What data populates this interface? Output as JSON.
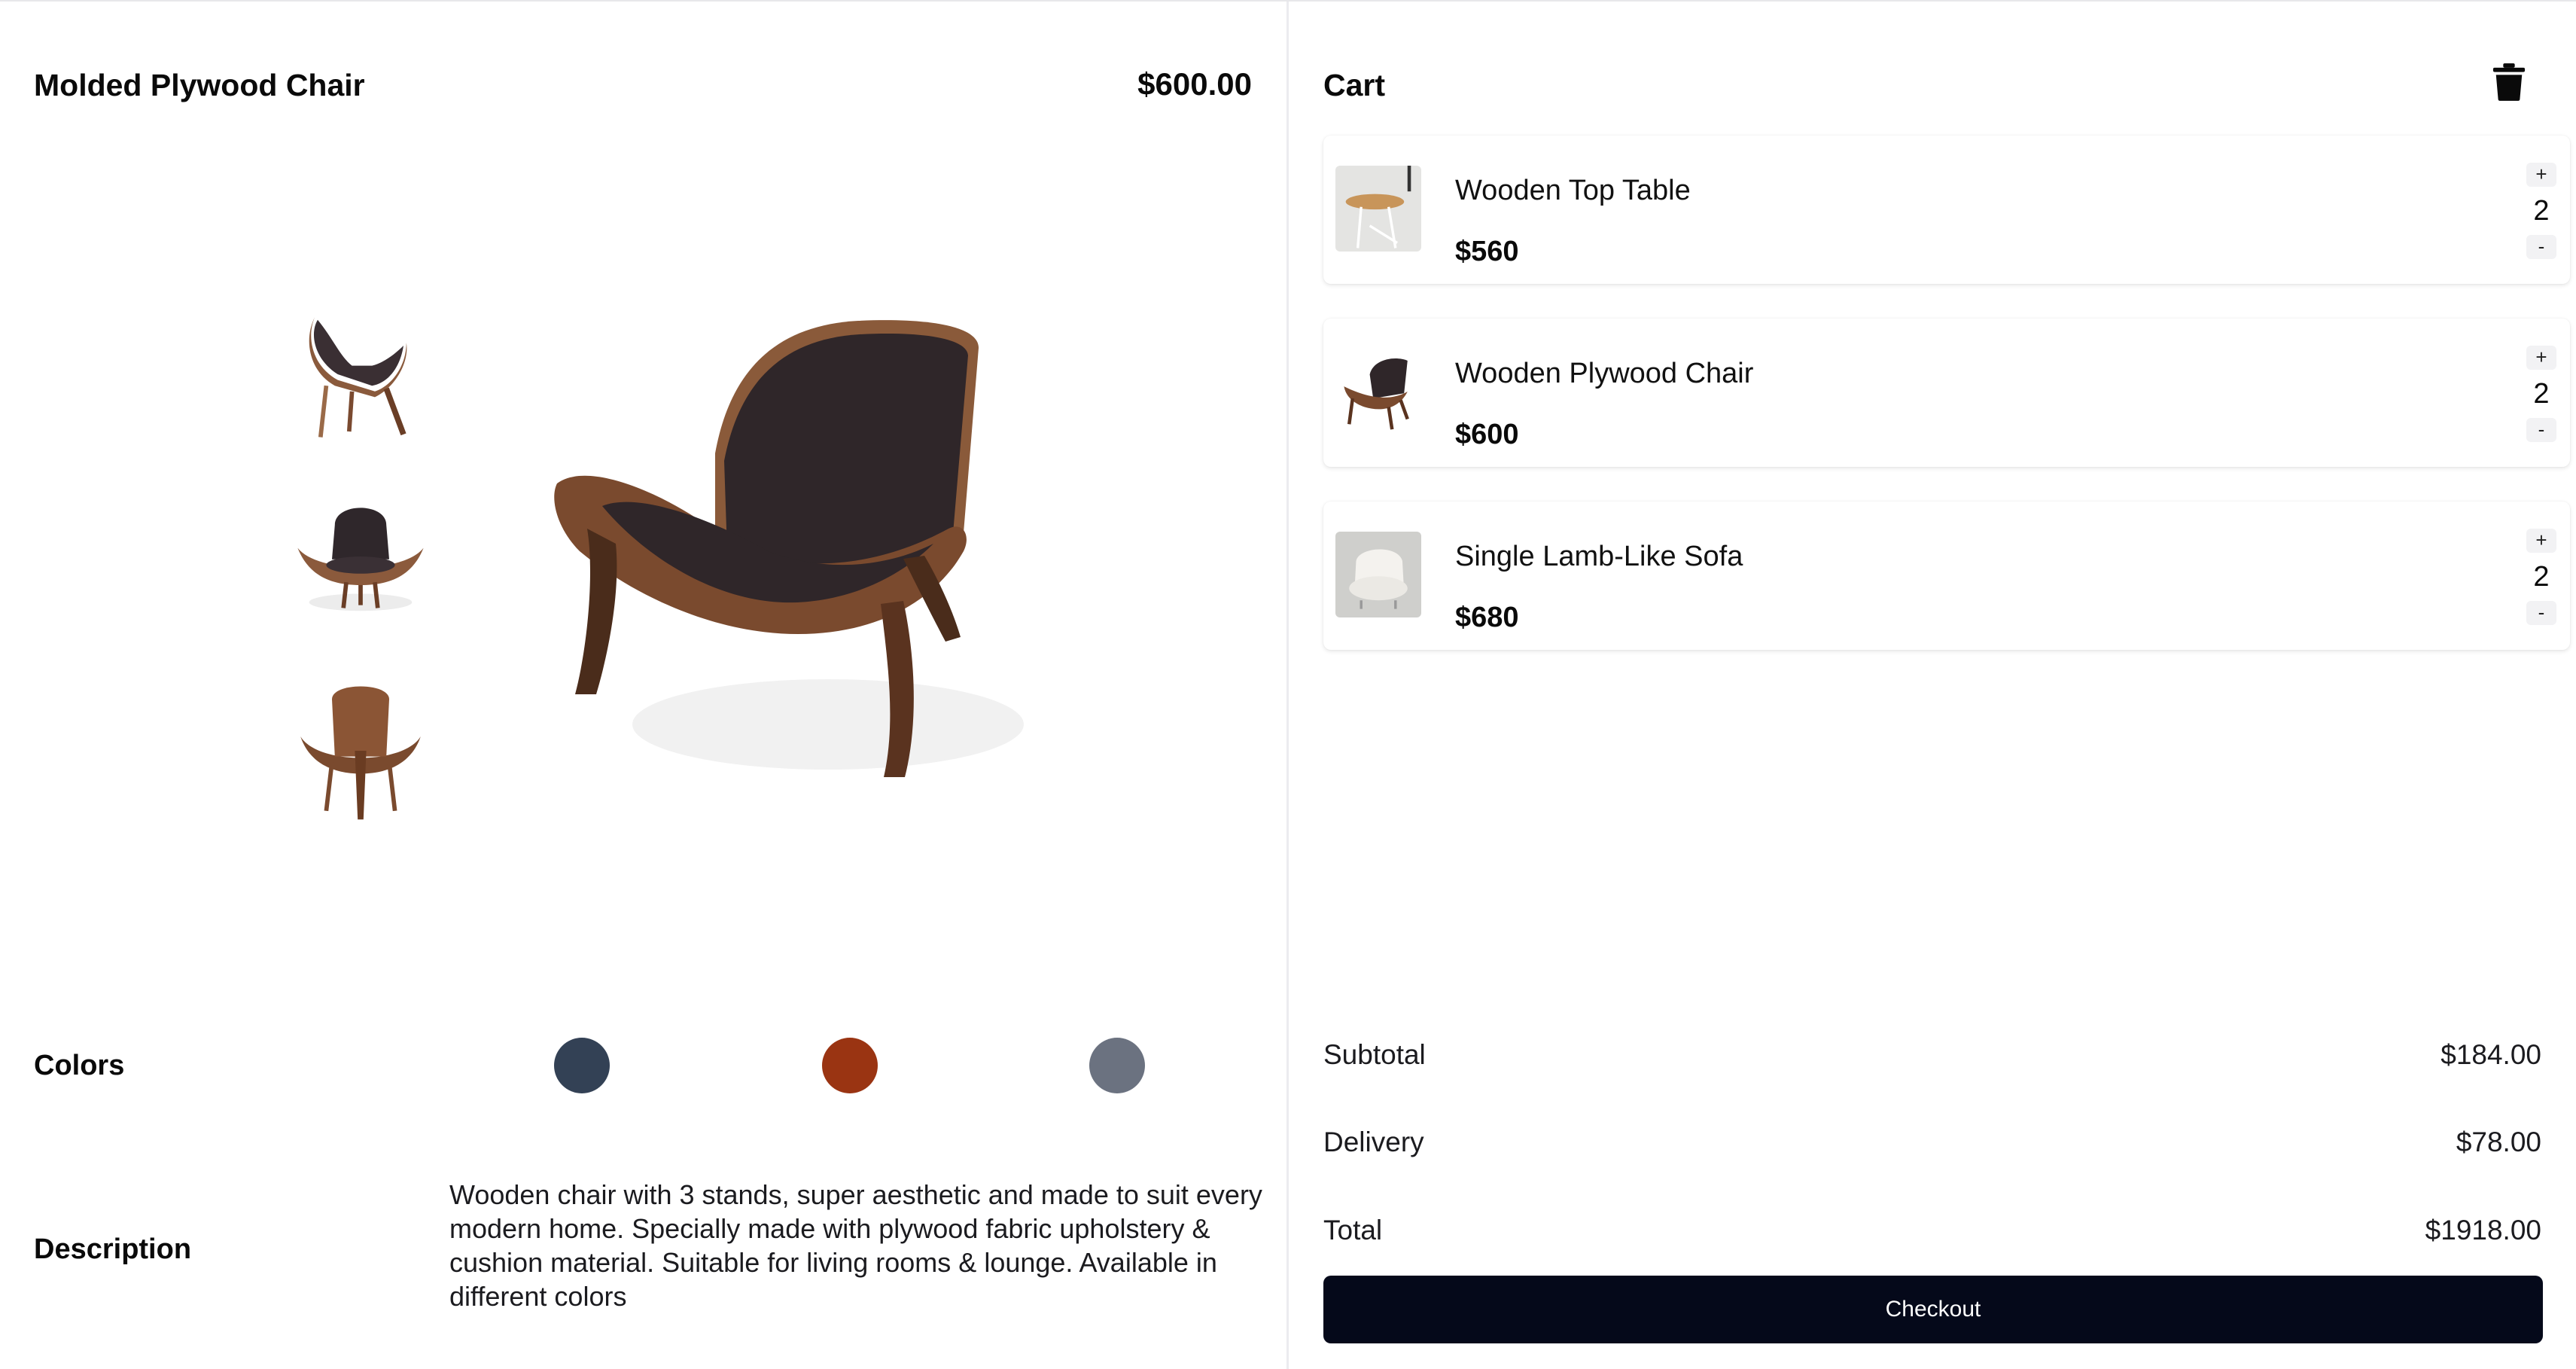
{
  "product": {
    "title": "Molded Plywood Chair",
    "price": "$600.00",
    "colors_label": "Colors",
    "colors": [
      "#334155",
      "#9a3412",
      "#6b7280"
    ],
    "description_label": "Description",
    "description": "Wooden chair with 3 stands, super aesthetic and made to suit every modern home. Specially made with plywood fabric upholstery & cushion material. Suitable for living rooms & lounge. Available in different colors"
  },
  "cart": {
    "title": "Cart",
    "items": [
      {
        "name": "Wooden Top Table",
        "price": "$560",
        "qty": "2",
        "plus": "+",
        "minus": "-"
      },
      {
        "name": "Wooden Plywood Chair",
        "price": "$600",
        "qty": "2",
        "plus": "+",
        "minus": "-"
      },
      {
        "name": "Single Lamb-Like Sofa",
        "price": "$680",
        "qty": "2",
        "plus": "+",
        "minus": "-"
      }
    ],
    "subtotal_label": "Subtotal",
    "subtotal": "$184.00",
    "delivery_label": "Delivery",
    "delivery": "$78.00",
    "total_label": "Total",
    "total": "$1918.00",
    "checkout_label": "Checkout"
  }
}
